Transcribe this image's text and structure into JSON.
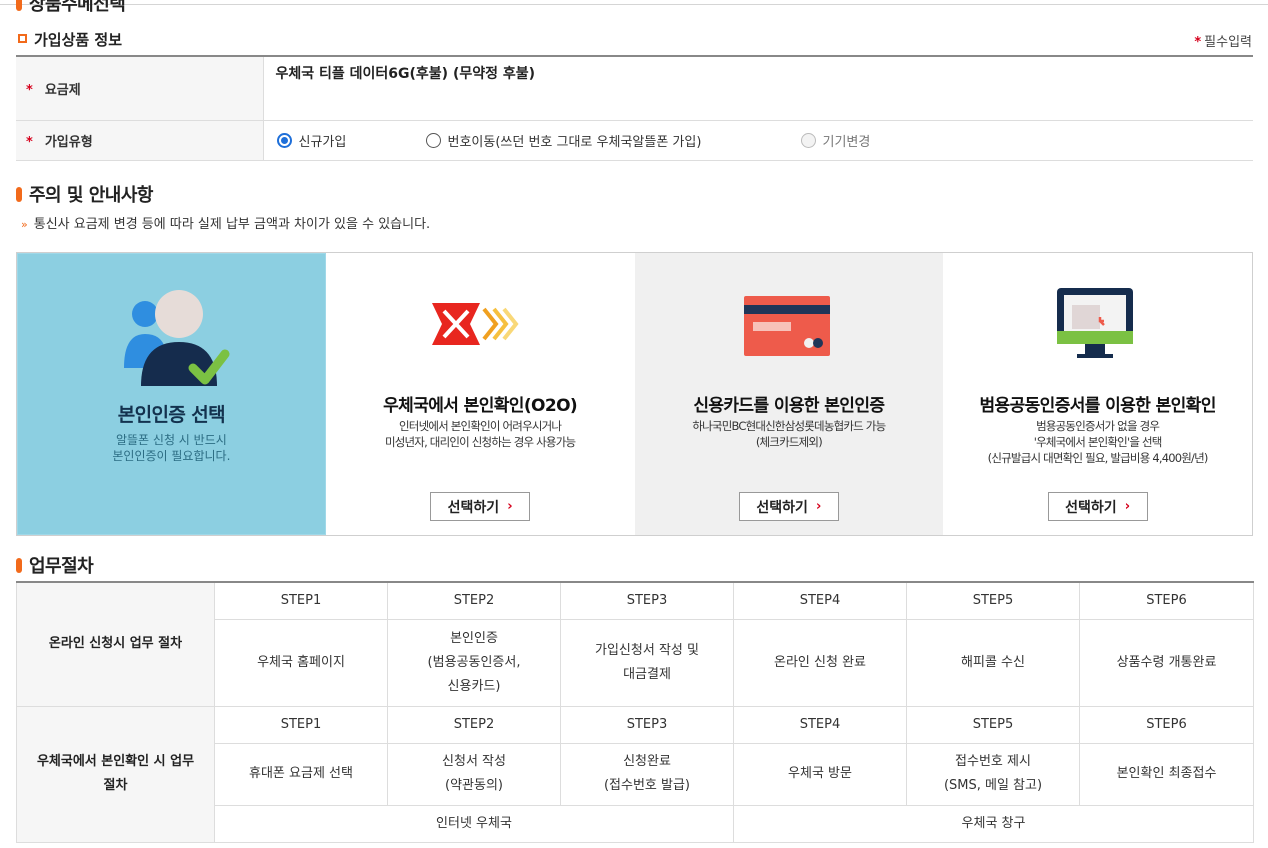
{
  "header": {
    "cut_title": "상품주메선택"
  },
  "product": {
    "section_title": "가입상품 정보",
    "required_note": "필수입력",
    "required_mark": "*",
    "plan_label": "요금제",
    "plan_value": "우체국 티플 데이터6G(후불) (무약정 후불)",
    "join_type_label": "가입유형",
    "options": [
      {
        "label": "신규가입",
        "state": "selected"
      },
      {
        "label": "번호이동(쓰던 번호 그대로 우체국알뜰폰 가입)",
        "state": "unselected"
      },
      {
        "label": "기기변경",
        "state": "disabled"
      }
    ]
  },
  "notice": {
    "title": "주의 및 안내사항",
    "text": "통신사 요금제 변경 등에 따라 실제 납부 금액과 차이가 있을 수 있습니다."
  },
  "auth": {
    "intro": {
      "title": "본인인증 선택",
      "desc_line1": "알뜰폰 신청 시 반드시",
      "desc_line2": "본인인증이 필요합니다."
    },
    "button_label": "선택하기",
    "cards": [
      {
        "title": "우체국에서 본인확인(O2O)",
        "desc_line1": "인터넷에서 본인확인이 어려우시거나",
        "desc_line2": "미성년자, 대리인이 신청하는 경우 사용가능",
        "desc_line3": ""
      },
      {
        "title": "신용카드를 이용한 본인인증",
        "desc_line1": "하나국민BC현대신한삼성롯데농협카드 가능",
        "desc_line2": "(체크카드제외)",
        "desc_line3": ""
      },
      {
        "title": "범용공동인증서를 이용한 본인확인",
        "desc_line1": "범용공동인증서가 없을 경우",
        "desc_line2": "'우체국에서 본인확인'을 선택",
        "desc_line3": "(신규발급시 대면확인 필요, 발급비용 4,400원/년)"
      }
    ]
  },
  "procedure": {
    "title": "업무절차",
    "steps": [
      "STEP1",
      "STEP2",
      "STEP3",
      "STEP4",
      "STEP5",
      "STEP6"
    ],
    "online": {
      "label": "온라인 신청시 업무 절차",
      "cells": [
        [
          "우체국 홈페이지"
        ],
        [
          "본인인증",
          "(범용공동인증서,",
          "신용카드)"
        ],
        [
          "가입신청서 작성 및",
          "대금결제"
        ],
        [
          "온라인 신청 완료"
        ],
        [
          "해피콜 수신"
        ],
        [
          "상품수령 개통완료"
        ]
      ]
    },
    "post": {
      "label_line1": "우체국에서 본인확인 시 업무",
      "label_line2": "절차",
      "cells": [
        [
          "휴대폰 요금제 선택"
        ],
        [
          "신청서 작성",
          "(약관동의)"
        ],
        [
          "신청완료",
          "(접수번호 발급)"
        ],
        [
          "우체국 방문"
        ],
        [
          "접수번호 제시",
          "(SMS, 메일 참고)"
        ],
        [
          "본인확인 최종접수"
        ]
      ],
      "channel_internet": "인터넷 우체국",
      "channel_counter": "우체국 창구"
    }
  },
  "colors": {
    "accent": "#f26a1b",
    "required": "#d6001c",
    "intro_bg": "#8ccfe1",
    "radio": "#1e6fd9"
  }
}
